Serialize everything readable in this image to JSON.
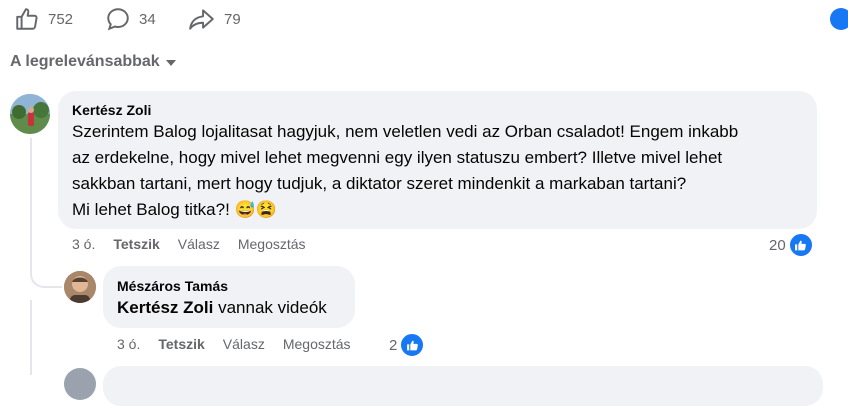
{
  "reactions": {
    "like_count": "752",
    "comment_count": "34",
    "share_count": "79"
  },
  "sort": {
    "label": "A legrelevánsabbak"
  },
  "comments": [
    {
      "author": "Kertész Zoli",
      "lines": [
        "Szerintem Balog lojalitasat hagyjuk, nem veletlen vedi az Orban csaladot! Engem inkabb",
        "az erdekelne, hogy mivel lehet megvenni egy ilyen statuszu embert? Illetve mivel lehet",
        "sakkban tartani, mert hogy tudjuk, a diktator szeret mindenkit a markaban tartani?",
        "Mi lehet Balog titka?!"
      ],
      "emoji": [
        "😅",
        "😫"
      ],
      "time": "3 ó.",
      "like_action": "Tetszik",
      "reply_action": "Válasz",
      "share_action": "Megosztás",
      "likes": "20"
    },
    {
      "author": "Mészáros Tamás",
      "mention": "Kertész Zoli",
      "text": "vannak videók",
      "time": "3 ó.",
      "like_action": "Tetszik",
      "reply_action": "Válasz",
      "share_action": "Megosztás",
      "likes": "2"
    }
  ],
  "colors": {
    "accent": "#1877f2",
    "bubble": "#f0f2f5",
    "muted": "#65676b"
  },
  "icons": [
    "thumbs-up-icon",
    "comment-icon",
    "share-icon",
    "like-badge-icon",
    "caret-down-icon"
  ]
}
